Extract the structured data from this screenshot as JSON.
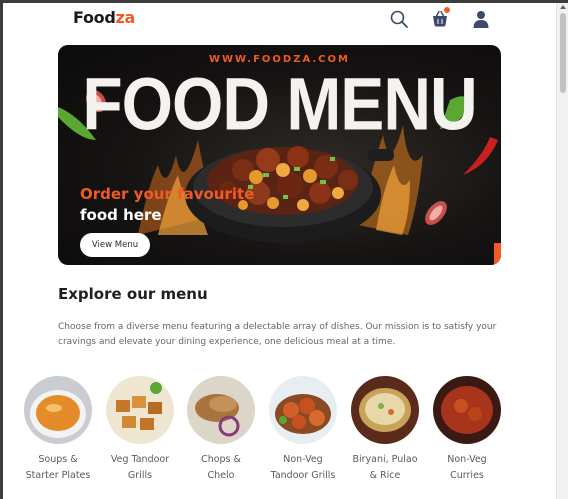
{
  "header": {
    "logo_main": "Food",
    "logo_accent": "za",
    "icons": [
      "search-icon",
      "cart-icon",
      "user-icon"
    ],
    "cart_badge_color": "#f15a24"
  },
  "hero": {
    "site": "WWW.FOODZA.COM",
    "title": "FOOD MENU",
    "subtitle_line1": "Order your favourite",
    "subtitle_line2": "food here",
    "button_label": "View Menu"
  },
  "explore": {
    "title": "Explore our menu",
    "description": "Choose from a diverse menu featuring a delectable array of dishes. Our mission is to satisfy your cravings and elevate your dining experience, one delicious meal at a time."
  },
  "categories": [
    {
      "label": "Soups &\nStarter Plates"
    },
    {
      "label": "Veg Tandoor\nGrills"
    },
    {
      "label": "Chops &\nChelo"
    },
    {
      "label": "Non-Veg\nTandoor Grills"
    },
    {
      "label": "Biryani, Pulao\n& Rice"
    },
    {
      "label": "Non-Veg\nCurries"
    }
  ],
  "colors": {
    "accent": "#f15a24",
    "text_dark": "#1f1f1f",
    "text_muted": "#666666"
  }
}
